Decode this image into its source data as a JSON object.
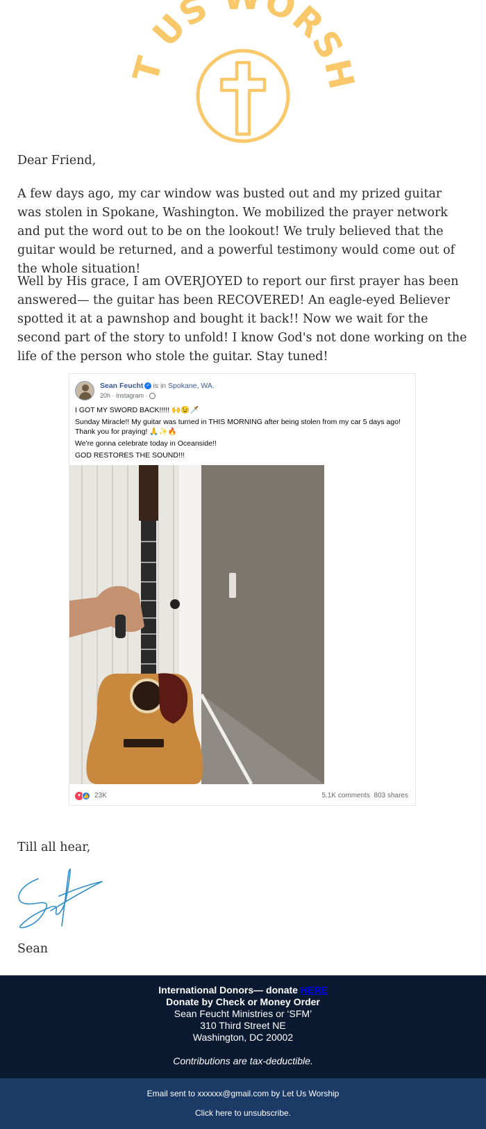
{
  "logo": {
    "text": "LET US WORSHIP",
    "color": "#f9c86a",
    "icon": "cross-in-circle-icon"
  },
  "letter": {
    "greeting": "Dear Friend,",
    "paragraph1": "A few days ago, my car window was busted out and my prized guitar was stolen in Spokane, Washington. We mobilized the prayer network and put the word out to be on the lookout! We truly believed that the guitar would be returned, and a powerful testimony would come out of the whole situation!",
    "paragraph2": "Well by His grace, I am OVERJOYED to report our first prayer has been answered— the guitar has been RECOVERED! An eagle-eyed Believer spotted it at a pawnshop and bought it back!! Now we wait for the second part of the story to unfold! I know God's not done working on the life of the person who stole the guitar. Stay tuned!",
    "closing": "Till all hear,",
    "signature_color": "#2f8fc9",
    "name": "Sean"
  },
  "post": {
    "author": "Sean Feucht",
    "is_in": "is in",
    "location": "Spokane, WA.",
    "meta": "20h · Instagram ·",
    "line1": "I GOT MY SWORD BACK!!!!! 🙌😉🗡️",
    "line2": "Sunday Miracle!! My guitar was turned in THIS MORNING after being stolen from my car 5 days ago!",
    "line3": "Thank you for praying! 🙏✨🔥",
    "line4": "We're gonna celebrate today in Oceanside!!",
    "line5": "GOD RESTORES THE SOUND!!!",
    "reactions": "23K",
    "comments": "5.1K comments",
    "shares": "803 shares",
    "colors": {
      "author": "#385898",
      "heart": "#f33e58",
      "like": "#1877f2"
    }
  },
  "footer": {
    "international_prefix": "International Donors— donate",
    "here_link": "HERE",
    "check_label": "Donate by Check or Money Order",
    "org_name": "Sean Feucht Ministries or ‘SFM’",
    "street": "310 Third Street NE",
    "city": "Washington, DC 20002",
    "tax_note": "Contributions are tax-deductible.",
    "sent_to": "Email sent to xxxxxx@gmail.com by Let Us Worship",
    "unsubscribe": "Click here to unsubscribe.",
    "colors": {
      "top": "#0b1931",
      "bottom": "#1c3a66"
    }
  }
}
